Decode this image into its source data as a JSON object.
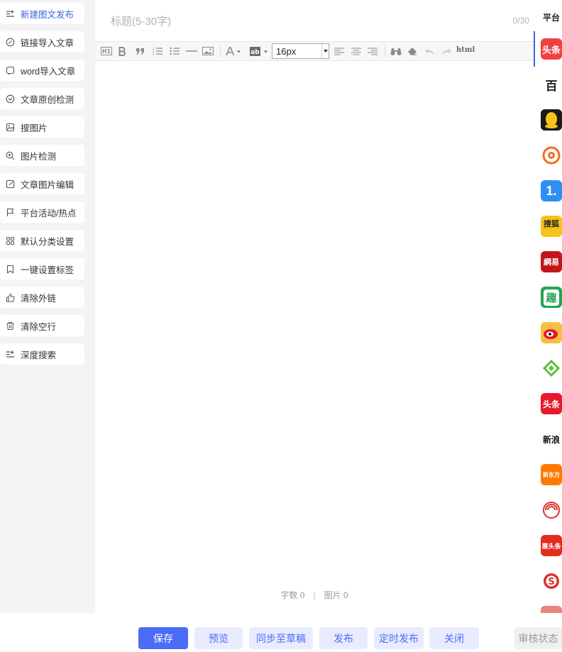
{
  "sidebar": {
    "items": [
      {
        "label": "新建图文发布",
        "icon": "new-post-icon",
        "active": true
      },
      {
        "label": "链接导入文章",
        "icon": "link-icon"
      },
      {
        "label": "word导入文章",
        "icon": "word-import-icon"
      },
      {
        "label": "文章原创检测",
        "icon": "original-check-icon"
      },
      {
        "label": "搜图片",
        "icon": "image-search-icon"
      },
      {
        "label": "图片检测",
        "icon": "zoom-check-icon"
      },
      {
        "label": "文章图片编辑",
        "icon": "edit-icon"
      },
      {
        "label": "平台活动/热点",
        "icon": "flag-icon"
      },
      {
        "label": "默认分类设置",
        "icon": "grid-icon"
      },
      {
        "label": "一键设置标签",
        "icon": "bookmark-icon"
      },
      {
        "label": "清除外链",
        "icon": "thumb-icon"
      },
      {
        "label": "清除空行",
        "icon": "trash-icon"
      },
      {
        "label": "深度搜索",
        "icon": "deep-search-icon"
      }
    ]
  },
  "editor": {
    "title_placeholder": "标题(5-30字)",
    "title_value": "",
    "title_counter": "0/30",
    "toolbar": {
      "font_size": "16px",
      "html_label": "html"
    },
    "stats": {
      "words": "字数 0",
      "separator": "|",
      "images": "图片 0"
    }
  },
  "platforms": {
    "title": "平台",
    "items": [
      {
        "name": "toutiao-logo",
        "text": "头条",
        "bg": "#f04142"
      },
      {
        "name": "baijiahao-logo",
        "text": "百",
        "bg": "#ffffff"
      },
      {
        "name": "qq-logo",
        "text": "",
        "bg": "#1a1a1a"
      },
      {
        "name": "weibo-orange-logo",
        "text": "",
        "bg": "#ffffff"
      },
      {
        "name": "yidian-logo",
        "text": "1.",
        "bg": "#2f8ef3"
      },
      {
        "name": "sohu-logo",
        "text": "搜狐",
        "bg": "#f6c31c"
      },
      {
        "name": "netease-logo",
        "text": "網易",
        "bg": "#c4151c"
      },
      {
        "name": "qutoutiao-logo",
        "text": "趣",
        "bg": "#21a553"
      },
      {
        "name": "sina-weibo-logo",
        "text": "",
        "bg": "#f6c046"
      },
      {
        "name": "green-logo",
        "text": "",
        "bg": "#ffffff"
      },
      {
        "name": "toutiao-2-logo",
        "text": "头条",
        "bg": "#e8192c"
      },
      {
        "name": "xinlang-logo",
        "text": "新浪",
        "bg": "#ffffff"
      },
      {
        "name": "orange-logo",
        "text": "新东方",
        "bg": "#ff7a00"
      },
      {
        "name": "fenghuang-logo",
        "text": "",
        "bg": "#ffffff"
      },
      {
        "name": "red-logo",
        "text": "惠头条",
        "bg": "#e22d1f"
      },
      {
        "name": "sougou-logo",
        "text": "S",
        "bg": "#ffffff"
      },
      {
        "name": "partial-logo",
        "text": "",
        "bg": "#e9857c"
      }
    ]
  },
  "footer": {
    "save": "保存",
    "preview": "预览",
    "sync_draft": "同步至草稿",
    "publish": "发布",
    "schedule": "定时发布",
    "close": "关闭",
    "review_status": "审核状态"
  },
  "colors": {
    "accent": "#4a6cf7",
    "accent_light": "#e9ecfe",
    "active_text": "#3b62e6",
    "page_bg": "#f4f4f5"
  }
}
